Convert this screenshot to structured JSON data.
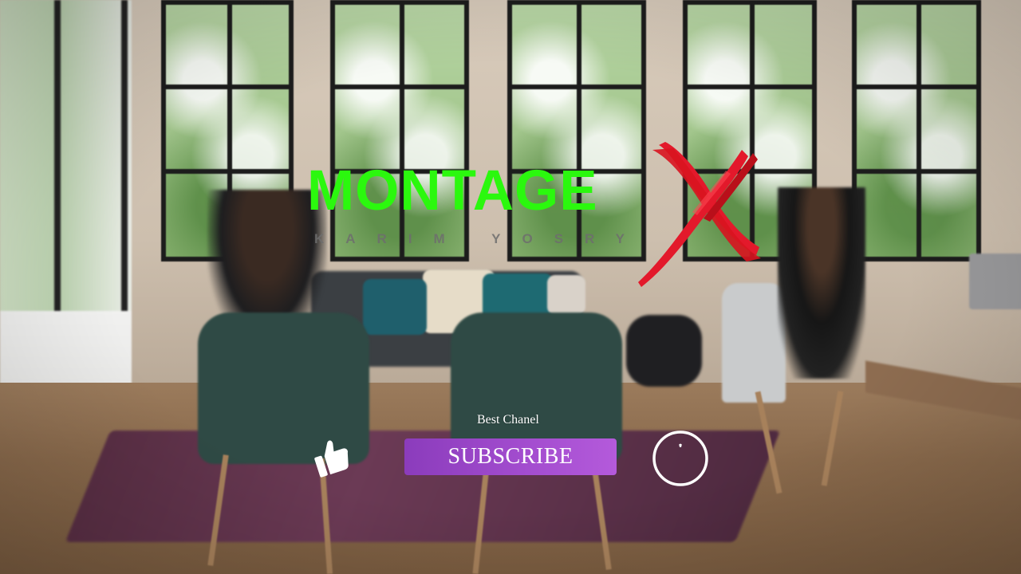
{
  "logo": {
    "title": "MONTAGE",
    "subtitle": "KARIM YOSRY",
    "mark": "X",
    "colors": {
      "title": "#2bf80e",
      "mark": "#e3192b",
      "subtitle": "#6e6e6e"
    }
  },
  "subscribe": {
    "channel_label": "Best Chanel",
    "button_label": "SUBSCRIBE",
    "colors": {
      "button_start": "#8b3cbc",
      "button_end": "#b45adb",
      "text": "#ffffff"
    },
    "icons": [
      "thumbs-up-icon",
      "notification-circle-icon"
    ]
  },
  "background": {
    "description_icon": "blurred-office-photo"
  }
}
